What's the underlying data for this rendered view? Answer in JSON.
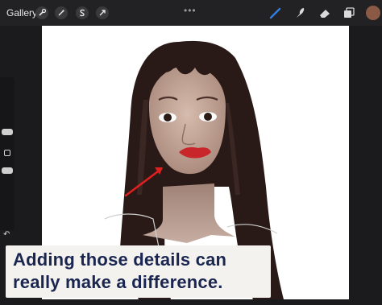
{
  "toolbar": {
    "gallery_label": "Gallery",
    "left_tools": [
      "wrench-icon",
      "magic-wand-icon",
      "selection-s-icon",
      "transform-arrow-icon"
    ],
    "more_glyph": "•••",
    "right_tools": [
      "brush-icon",
      "smudge-icon",
      "eraser-icon",
      "layers-icon",
      "color-swatch"
    ],
    "accent_color": "#2f7fe0",
    "color_swatch": "#8a5a44"
  },
  "sidebar": {
    "controls": [
      "brush-size-slider",
      "modify-square-button",
      "opacity-slider",
      "undo-icon"
    ]
  },
  "canvas": {
    "background": "#ffffff",
    "content": "digital portrait painting"
  },
  "caption": {
    "line1": "Adding those details can",
    "line2": "really make a difference."
  },
  "annotation": {
    "arrow_color": "#e02020"
  }
}
